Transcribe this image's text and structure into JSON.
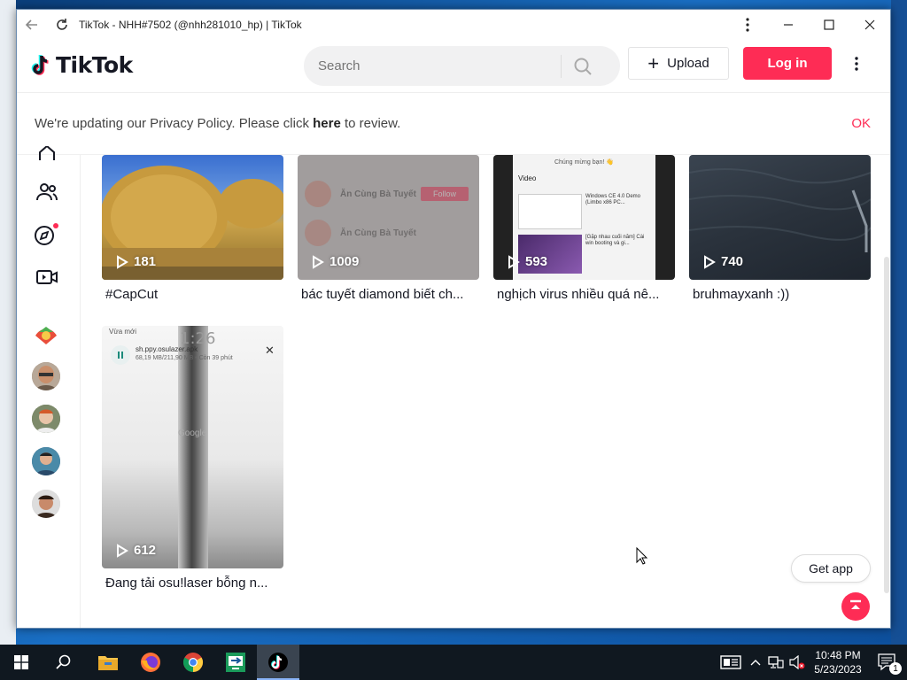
{
  "browser": {
    "title": "TikTok - NHH#7502 (@nhh281010_hp) | TikTok"
  },
  "header": {
    "logo_text": "TikTok",
    "search_placeholder": "Search",
    "upload_label": "Upload",
    "login_label": "Log in"
  },
  "privacy_banner": {
    "text_before": "We're updating our Privacy Policy. Please click ",
    "link_text": "here",
    "text_after": " to review.",
    "ok_label": "OK"
  },
  "videos": [
    {
      "views": "181",
      "caption": "#CapCut"
    },
    {
      "views": "1009",
      "caption": "bác tuyết diamond biết ch..."
    },
    {
      "views": "593",
      "caption": "nghịch virus nhiều quá nê..."
    },
    {
      "views": "740",
      "caption": "bruhmayxanh :))"
    },
    {
      "views": "612",
      "caption": "Đang tải osu!laser bỗng n..."
    }
  ],
  "thumb_text": {
    "v2_name": "Ăn Cùng Bà Tuyết",
    "v2_follow": "Follow",
    "v3_header": "Chúng mừng bạn! 👋",
    "v3_section": "Video",
    "v3_item1": "Windows CE 4.0 Demo (Limbo x86 PC...",
    "v3_item2": "[Gặp nhau cuối năm] Cài win booting và gi...",
    "v5_top": "Vừa mới",
    "v5_time": "1:26",
    "v5_file": "sh.ppy.osulazer.apk",
    "v5_progress": "68,19 MB/211,90 MB • Còn 39 phút",
    "v5_google": "Google"
  },
  "floating": {
    "get_app_label": "Get app"
  },
  "taskbar": {
    "time": "10:48 PM",
    "date": "5/23/2023",
    "notification_count": "1"
  },
  "colors": {
    "accent": "#fe2c55",
    "text": "#161823"
  }
}
